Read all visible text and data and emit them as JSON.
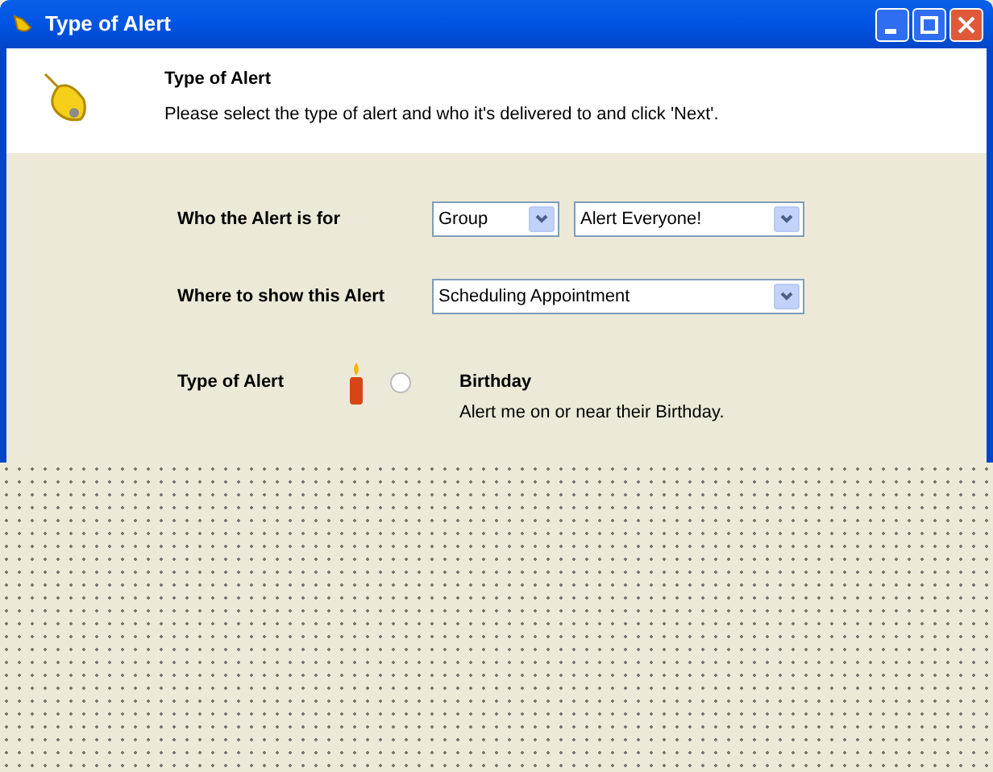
{
  "window": {
    "title": "Type of Alert"
  },
  "header": {
    "title": "Type of Alert",
    "description": "Please select the type of alert and who it's delivered to and click 'Next'."
  },
  "recipient": {
    "label": "Who the Alert is for",
    "scope": "Group",
    "target": "Alert Everyone!"
  },
  "location": {
    "label": "Where to show this Alert",
    "value": "Scheduling Appointment"
  },
  "alert_type": {
    "label": "Type of Alert",
    "options": [
      {
        "title": "Birthday",
        "description": "Alert me on or near their Birthday.",
        "selected": false
      }
    ]
  }
}
